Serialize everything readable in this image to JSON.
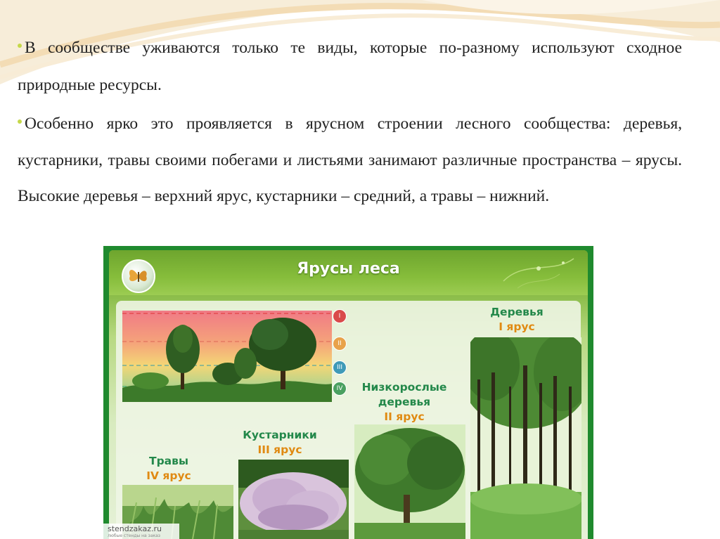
{
  "bullets": [
    "В сообществе уживаются только те виды, которые по-разному используют сходное природные ресурсы.",
    "Особенно ярко это проявляется в ярусном строении лесного сообщества: деревья, кустарники, травы своими побегами и листьями занимают различные пространства – ярусы. Высокие деревья – верхний ярус, кустарники – средний, а травы – нижний."
  ],
  "poster": {
    "title": "Ярусы леса",
    "tier_markers": [
      "I",
      "II",
      "III",
      "IV"
    ],
    "trees": {
      "name": "Деревья",
      "tier": "I ярус"
    },
    "small_trees": {
      "name1": "Низкорослые",
      "name2": "деревья",
      "tier": "II ярус"
    },
    "shrubs": {
      "name": "Кустарники",
      "tier": "III ярус"
    },
    "grass": {
      "name": "Травы",
      "tier": "IV ярус"
    },
    "watermark": "stendzakaz.ru",
    "watermark_sub": "любые стенды на заказ"
  },
  "colors": {
    "bullet_dot": "#c5d84a",
    "poster_frame": "#1f8a2e",
    "label_green": "#23884a",
    "label_orange": "#e08a12"
  }
}
